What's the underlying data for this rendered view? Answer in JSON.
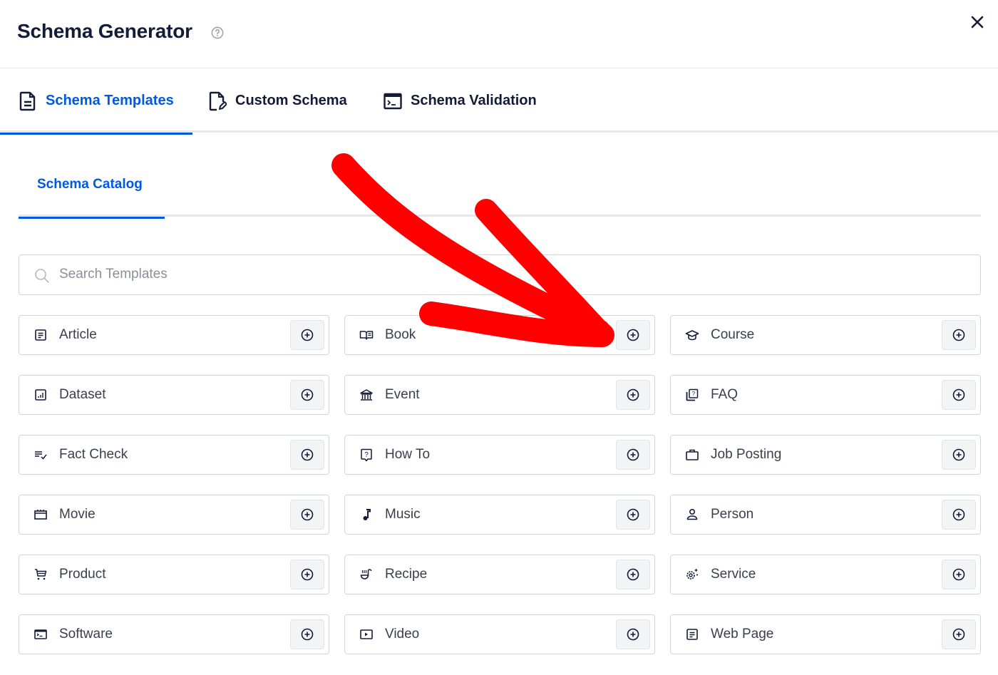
{
  "header": {
    "title": "Schema Generator",
    "help_icon": "question-circle-icon",
    "close_icon": "close-x-icon"
  },
  "tabs": [
    {
      "label": "Schema Templates",
      "icon": "document-icon",
      "active": true
    },
    {
      "label": "Custom Schema",
      "icon": "document-edit-icon",
      "active": false
    },
    {
      "label": "Schema Validation",
      "icon": "terminal-window-icon",
      "active": false
    }
  ],
  "subtabs": [
    {
      "label": "Schema Catalog",
      "active": true
    }
  ],
  "search": {
    "placeholder": "Search Templates",
    "value": "",
    "icon": "search-icon"
  },
  "templates": [
    {
      "label": "Article",
      "icon": "article-icon"
    },
    {
      "label": "Book",
      "icon": "open-book-icon"
    },
    {
      "label": "Course",
      "icon": "graduation-cap-icon"
    },
    {
      "label": "Dataset",
      "icon": "chart-box-icon"
    },
    {
      "label": "Event",
      "icon": "building-columns-icon"
    },
    {
      "label": "FAQ",
      "icon": "question-stack-icon"
    },
    {
      "label": "Fact Check",
      "icon": "list-check-icon"
    },
    {
      "label": "How To",
      "icon": "question-bubble-icon"
    },
    {
      "label": "Job Posting",
      "icon": "briefcase-icon"
    },
    {
      "label": "Movie",
      "icon": "clapperboard-icon"
    },
    {
      "label": "Music",
      "icon": "music-note-icon"
    },
    {
      "label": "Person",
      "icon": "person-icon"
    },
    {
      "label": "Product",
      "icon": "shopping-cart-icon"
    },
    {
      "label": "Recipe",
      "icon": "ladle-icon"
    },
    {
      "label": "Service",
      "icon": "gear-sparkle-icon"
    },
    {
      "label": "Software",
      "icon": "terminal-icon"
    },
    {
      "label": "Video",
      "icon": "play-box-icon"
    },
    {
      "label": "Web Page",
      "icon": "web-page-icon"
    }
  ],
  "add_button_icon": "plus-circle-icon",
  "annotation": {
    "type": "red-arrow",
    "color": "#ff0000",
    "points_to": "Book add button"
  },
  "colors": {
    "accent": "#005ae0",
    "title": "#141b38",
    "text": "#3a3f4c",
    "border": "#d1d5db",
    "button_bg": "#f3f4f6"
  }
}
